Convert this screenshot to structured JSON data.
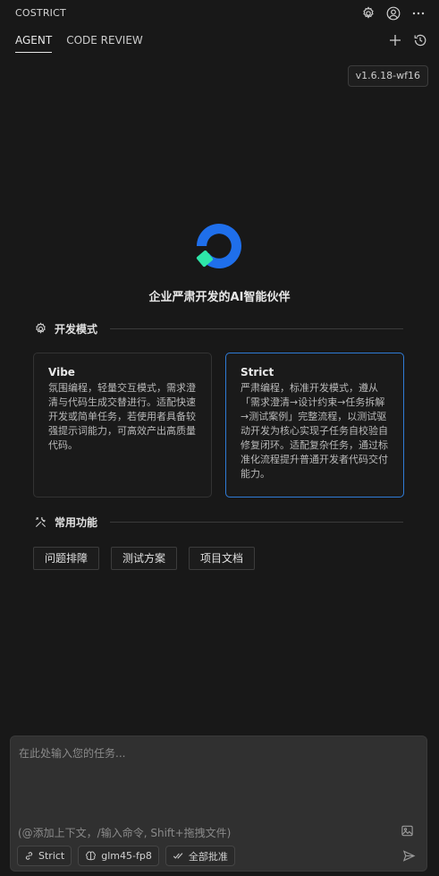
{
  "app": {
    "title": "COSTRICT"
  },
  "header_icons": [
    "gear-icon",
    "account-icon",
    "more-icon"
  ],
  "tabs": [
    {
      "label": "AGENT",
      "active": true
    },
    {
      "label": "CODE REVIEW",
      "active": false
    }
  ],
  "tab_actions": [
    "plus-icon",
    "history-icon"
  ],
  "version": "v1.6.18-wf16",
  "hero": {
    "tagline": "企业严肃开发的AI智能伙伴"
  },
  "dev_mode": {
    "heading": "开发模式",
    "cards": [
      {
        "title": "Vibe",
        "description": "氛围编程，轻量交互模式，需求澄清与代码生成交替进行。适配快速开发或简单任务，若使用者具备较强提示词能力，可高效产出高质量代码。",
        "selected": false
      },
      {
        "title": "Strict",
        "description": "严肃编程，标准开发模式，遵从「需求澄清→设计约束→任务拆解→测试案例」完整流程，以测试驱动开发为核心实现子任务自校验自修复闭环。适配复杂任务，通过标准化流程提升普通开发者代码交付能力。",
        "selected": true
      }
    ]
  },
  "common": {
    "heading": "常用功能",
    "items": [
      "问题排障",
      "测试方案",
      "项目文档"
    ]
  },
  "composer": {
    "placeholder": "在此处输入您的任务...",
    "value": "",
    "hint": "(@添加上下文，/输入命令, Shift+拖拽文件)",
    "mode_label": "Strict",
    "model_label": "glm45-fp8",
    "approve_label": "全部批准"
  },
  "colors": {
    "accent": "#2f7bd6",
    "background": "#181818",
    "composer_bg": "#303030",
    "logo_blue": "#1f6feb",
    "logo_green": "#2ee6a8"
  }
}
